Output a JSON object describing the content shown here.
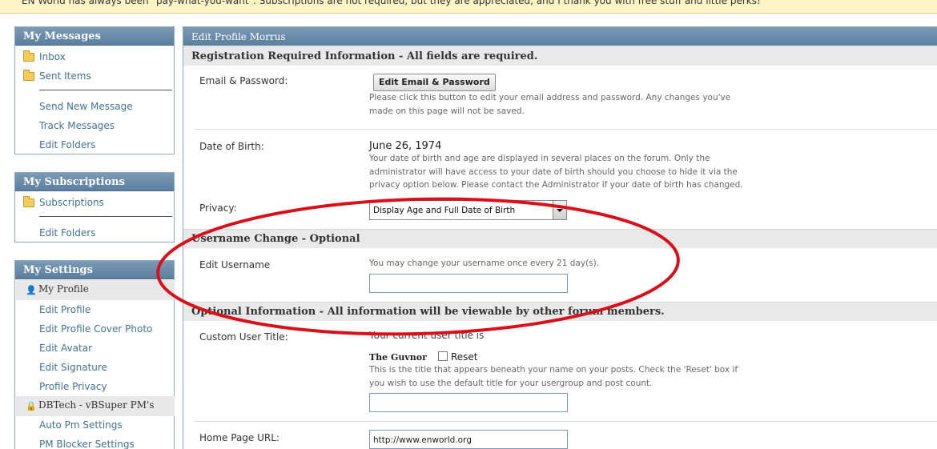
{
  "notice": "EN World has always been \"pay-what-you-want\". Subscriptions are not required, but they are appreciated, and I thank you with free stuff and little perks!",
  "sidebar": {
    "messages": {
      "title": "My Messages",
      "folders": [
        "Inbox",
        "Sent Items"
      ],
      "links": [
        "Send New Message",
        "Track Messages",
        "Edit Folders"
      ]
    },
    "subscriptions": {
      "title": "My Subscriptions",
      "folders": [
        "Subscriptions"
      ],
      "links": [
        "Edit Folders"
      ]
    },
    "settings": {
      "title": "My Settings",
      "profile_heading": "My Profile",
      "profile_links": [
        "Edit Profile",
        "Edit Profile Cover Photo",
        "Edit Avatar",
        "Edit Signature",
        "Profile Privacy"
      ],
      "dbtech_heading": "DBTech - vBSuper PM's",
      "dbtech_links": [
        "Auto Pm Settings",
        "PM Blocker Settings"
      ]
    }
  },
  "main": {
    "title": "Edit Profile Morrus",
    "registration": {
      "heading": "Registration Required Information - All fields are required.",
      "email_label": "Email & Password:",
      "email_button": "Edit Email & Password",
      "email_desc": "Please click this button to edit your email address and password. Any changes you've made on this page will not be saved.",
      "dob_label": "Date of Birth:",
      "dob_value": "June 26, 1974",
      "dob_desc": "Your date of birth and age are displayed in several places on the forum. Only the administrator will have access to your date of birth should you choose to hide it via the privacy option below. Please contact the Administrator if your date of birth has changed.",
      "privacy_label": "Privacy:",
      "privacy_selected": "Display Age and Full Date of Birth"
    },
    "username": {
      "heading": "Username Change - Optional",
      "label": "Edit Username",
      "desc": "You may change your username once every 21 day(s).",
      "value": ""
    },
    "optional": {
      "heading": "Optional Information - All information will be viewable by other forum members.",
      "title_label": "Custom User Title:",
      "current_title_text": "Your current user title is",
      "current_title": "The Guvnor",
      "reset_label": "Reset",
      "title_desc": "This is the title that appears beneath your name on your posts. Check the 'Reset' box if you wish to use the default title for your usergroup and post count.",
      "title_value": "",
      "homepage_label": "Home Page URL:",
      "homepage_value": "http://www.enworld.org"
    }
  },
  "colors": {
    "block_header": "#6a8aa8",
    "link": "#417394",
    "annotation_ellipse": "#d9101a"
  }
}
